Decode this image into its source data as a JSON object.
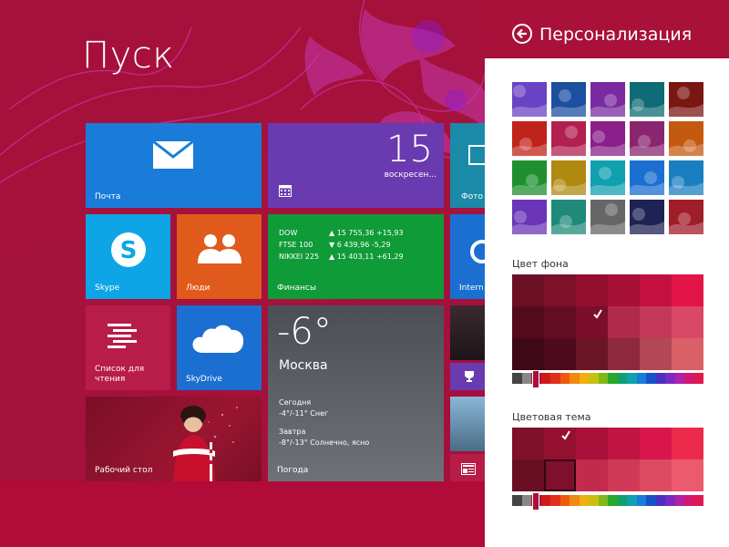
{
  "start": {
    "title": "Пуск"
  },
  "tiles": {
    "mail": {
      "label": "Почта",
      "color": "#1a7cd9"
    },
    "calendar": {
      "day": "15",
      "weekday": "воскресен...",
      "color": "#6a3ab0"
    },
    "photos": {
      "label": "Фото",
      "color": "#1a8aa8"
    },
    "skype": {
      "label": "Skype",
      "color": "#0ea5e6"
    },
    "people": {
      "label": "Люди",
      "color": "#e05a1c"
    },
    "finance": {
      "label": "Финансы",
      "color": "#0f9b37",
      "rows": [
        {
          "name": "DOW",
          "value": "▲ 15 755,36 +15,93"
        },
        {
          "name": "FTSE 100",
          "value": "▼ 6 439,96 -5,29"
        },
        {
          "name": "NIKKEI 225",
          "value": "▲ 15 403,11 +61,29"
        }
      ]
    },
    "ie": {
      "label": "Intern",
      "color": "#1a6fd1"
    },
    "reading": {
      "label": "Список для чтения",
      "color": "#b81c49"
    },
    "skydrive": {
      "label": "SkyDrive",
      "color": "#1a6fd1"
    },
    "weather": {
      "label": "Погода",
      "temp": "-6°",
      "city": "Москва",
      "today_label": "Сегодня",
      "today": "-4°/-11° Снег",
      "tomorrow_label": "Завтра",
      "tomorrow": "-8°/-13° Солнечно, ясно"
    },
    "desktop": {
      "label": "Рабочий стол"
    }
  },
  "pane": {
    "title": "Персонализация",
    "bg_section": "Цвет фона",
    "theme_section": "Цветовая тема",
    "accent": "#a9103a"
  },
  "patterns": [
    [
      "#6a43c5",
      "#1c4fa0",
      "#7a2aa0",
      "#0f6b75",
      "#7a1712"
    ],
    [
      "#c0231a",
      "#b22050",
      "#8a1f8a",
      "#8a2570",
      "#c45a10"
    ],
    [
      "#1f8f2f",
      "#b08a10",
      "#10a0b0",
      "#1a6fd1",
      "#1a7fc0"
    ],
    [
      "#6a35b8",
      "#1f8a7a",
      "#666666",
      "#1f2255",
      "#a01d2a"
    ]
  ],
  "background_colors": [
    [
      "#6c0f25",
      "#7e1029",
      "#920f2e",
      "#a71036",
      "#c41040",
      "#e21448"
    ],
    [
      "#540b1d",
      "#650d24",
      "#7a0e2c",
      "#b02a4c",
      "#c43858",
      "#d94865"
    ],
    [
      "#3e0816",
      "#4e0a1d",
      "#6a1628",
      "#8c2a3b",
      "#b34854",
      "#d86066"
    ]
  ],
  "theme_colors": [
    [
      "#7e1029",
      "#941031",
      "#a9103a",
      "#c01444",
      "#d8164b",
      "#ec2b4c"
    ],
    [
      "#6a0e24",
      "#7f0f2c",
      "#c32b4c",
      "#d13a57",
      "#de4a62",
      "#ec5a6e"
    ]
  ],
  "strip_colors": [
    "#444444",
    "#888888",
    "#a9103a",
    "#d01a1a",
    "#e0301a",
    "#f05a10",
    "#f08a10",
    "#f0b010",
    "#c8c010",
    "#80b81a",
    "#2aa82a",
    "#10a070",
    "#10a0b0",
    "#1a7cd9",
    "#1a50c8",
    "#4a30c0",
    "#7a2ac0",
    "#b020a8",
    "#d01870",
    "#e01850"
  ]
}
